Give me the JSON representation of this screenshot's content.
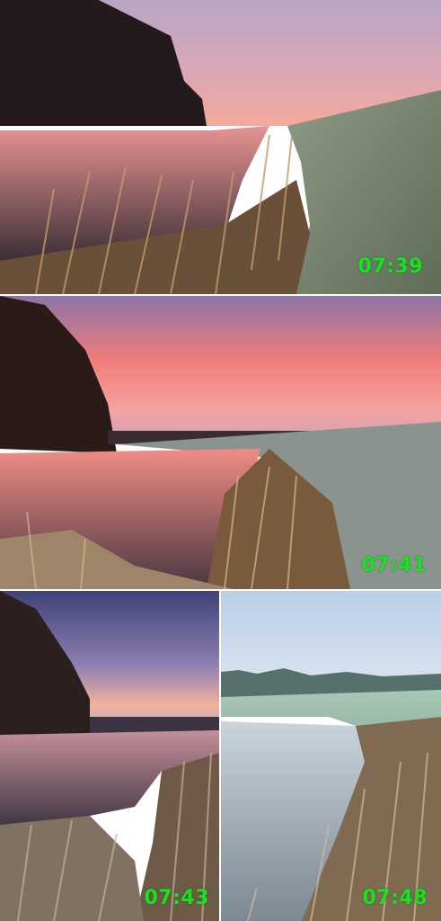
{
  "photos": [
    {
      "time": "07:39",
      "scene": "sunrise-river-0739"
    },
    {
      "time": "07:41",
      "scene": "sunrise-river-0741"
    },
    {
      "time": "07:43",
      "scene": "sunrise-river-0743"
    },
    {
      "time": "07:48",
      "scene": "sunrise-river-0748"
    }
  ],
  "colors": {
    "timestamp": "#13e61a"
  }
}
